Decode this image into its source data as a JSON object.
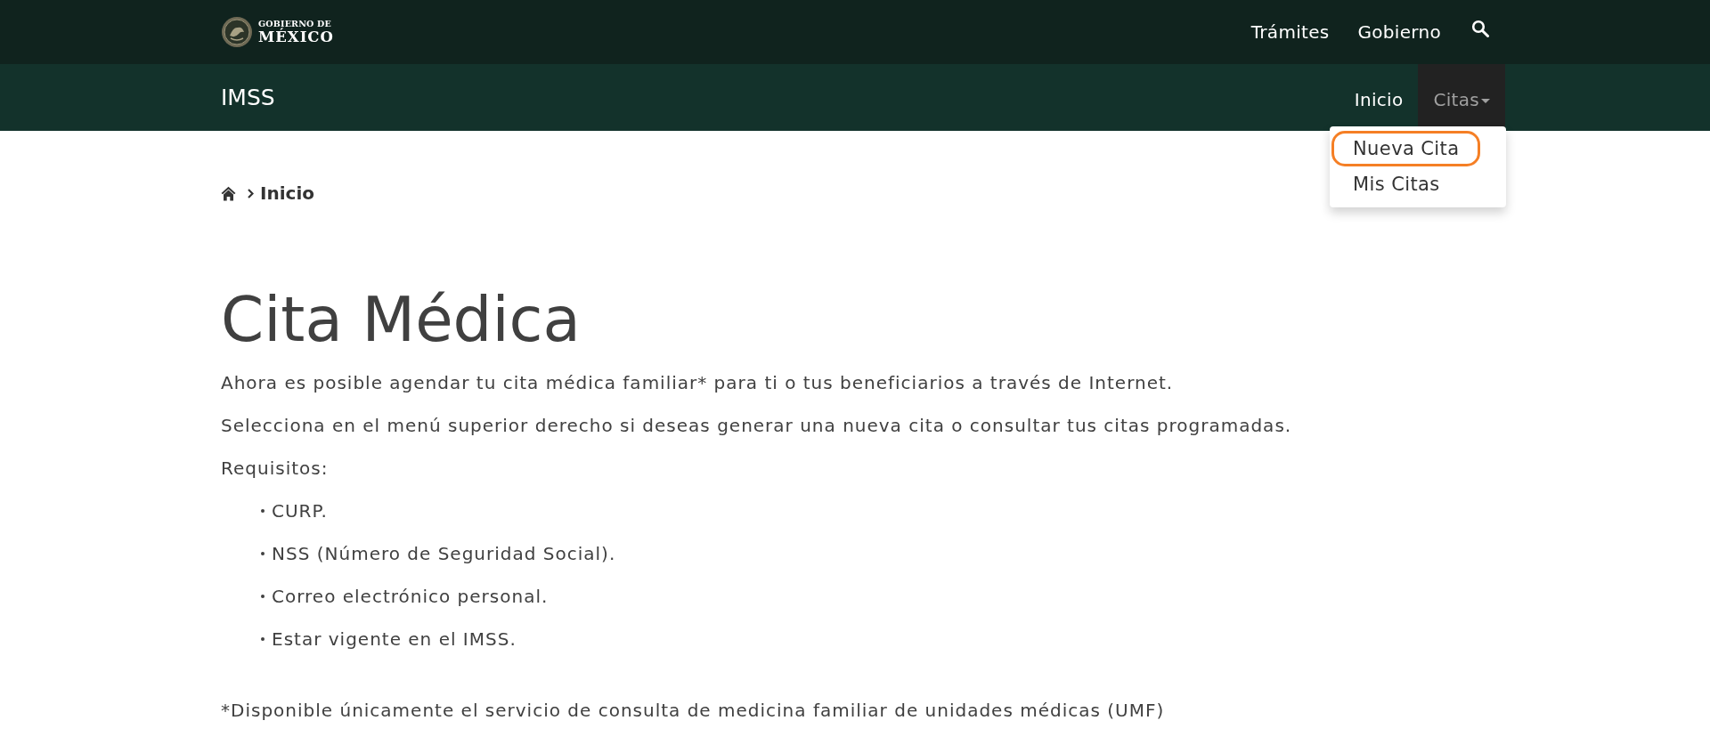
{
  "header": {
    "logo": {
      "line_1": "GOBIERNO DE",
      "line_2": "MÉXICO"
    },
    "links": [
      {
        "label": "Trámites"
      },
      {
        "label": "Gobierno"
      }
    ]
  },
  "subnav": {
    "title": "IMSS",
    "items": [
      {
        "label": "Inicio",
        "kind": "link",
        "open": false
      },
      {
        "label": "Citas",
        "kind": "dropdown",
        "open": true,
        "menu": [
          {
            "label": "Nueva Cita",
            "highlighted": true
          },
          {
            "label": "Mis Citas",
            "highlighted": false
          }
        ]
      }
    ]
  },
  "breadcrumb": {
    "items": [
      {
        "label": "Inicio"
      }
    ]
  },
  "main": {
    "title": "Cita Médica",
    "paragraphs": [
      "Ahora es posible agendar tu cita médica familiar* para ti o tus beneficiarios a través de Internet.",
      "Selecciona en el menú superior derecho si deseas generar una nueva cita o consultar tus citas programadas.",
      "Requisitos:"
    ],
    "requirements": [
      "CURP.",
      "NSS (Número de Seguridad Social).",
      "Correo electrónico personal.",
      "Estar vigente en el IMSS."
    ],
    "footnote": "*Disponible únicamente el servicio de consulta de medicina familiar de unidades médicas (UMF)"
  }
}
